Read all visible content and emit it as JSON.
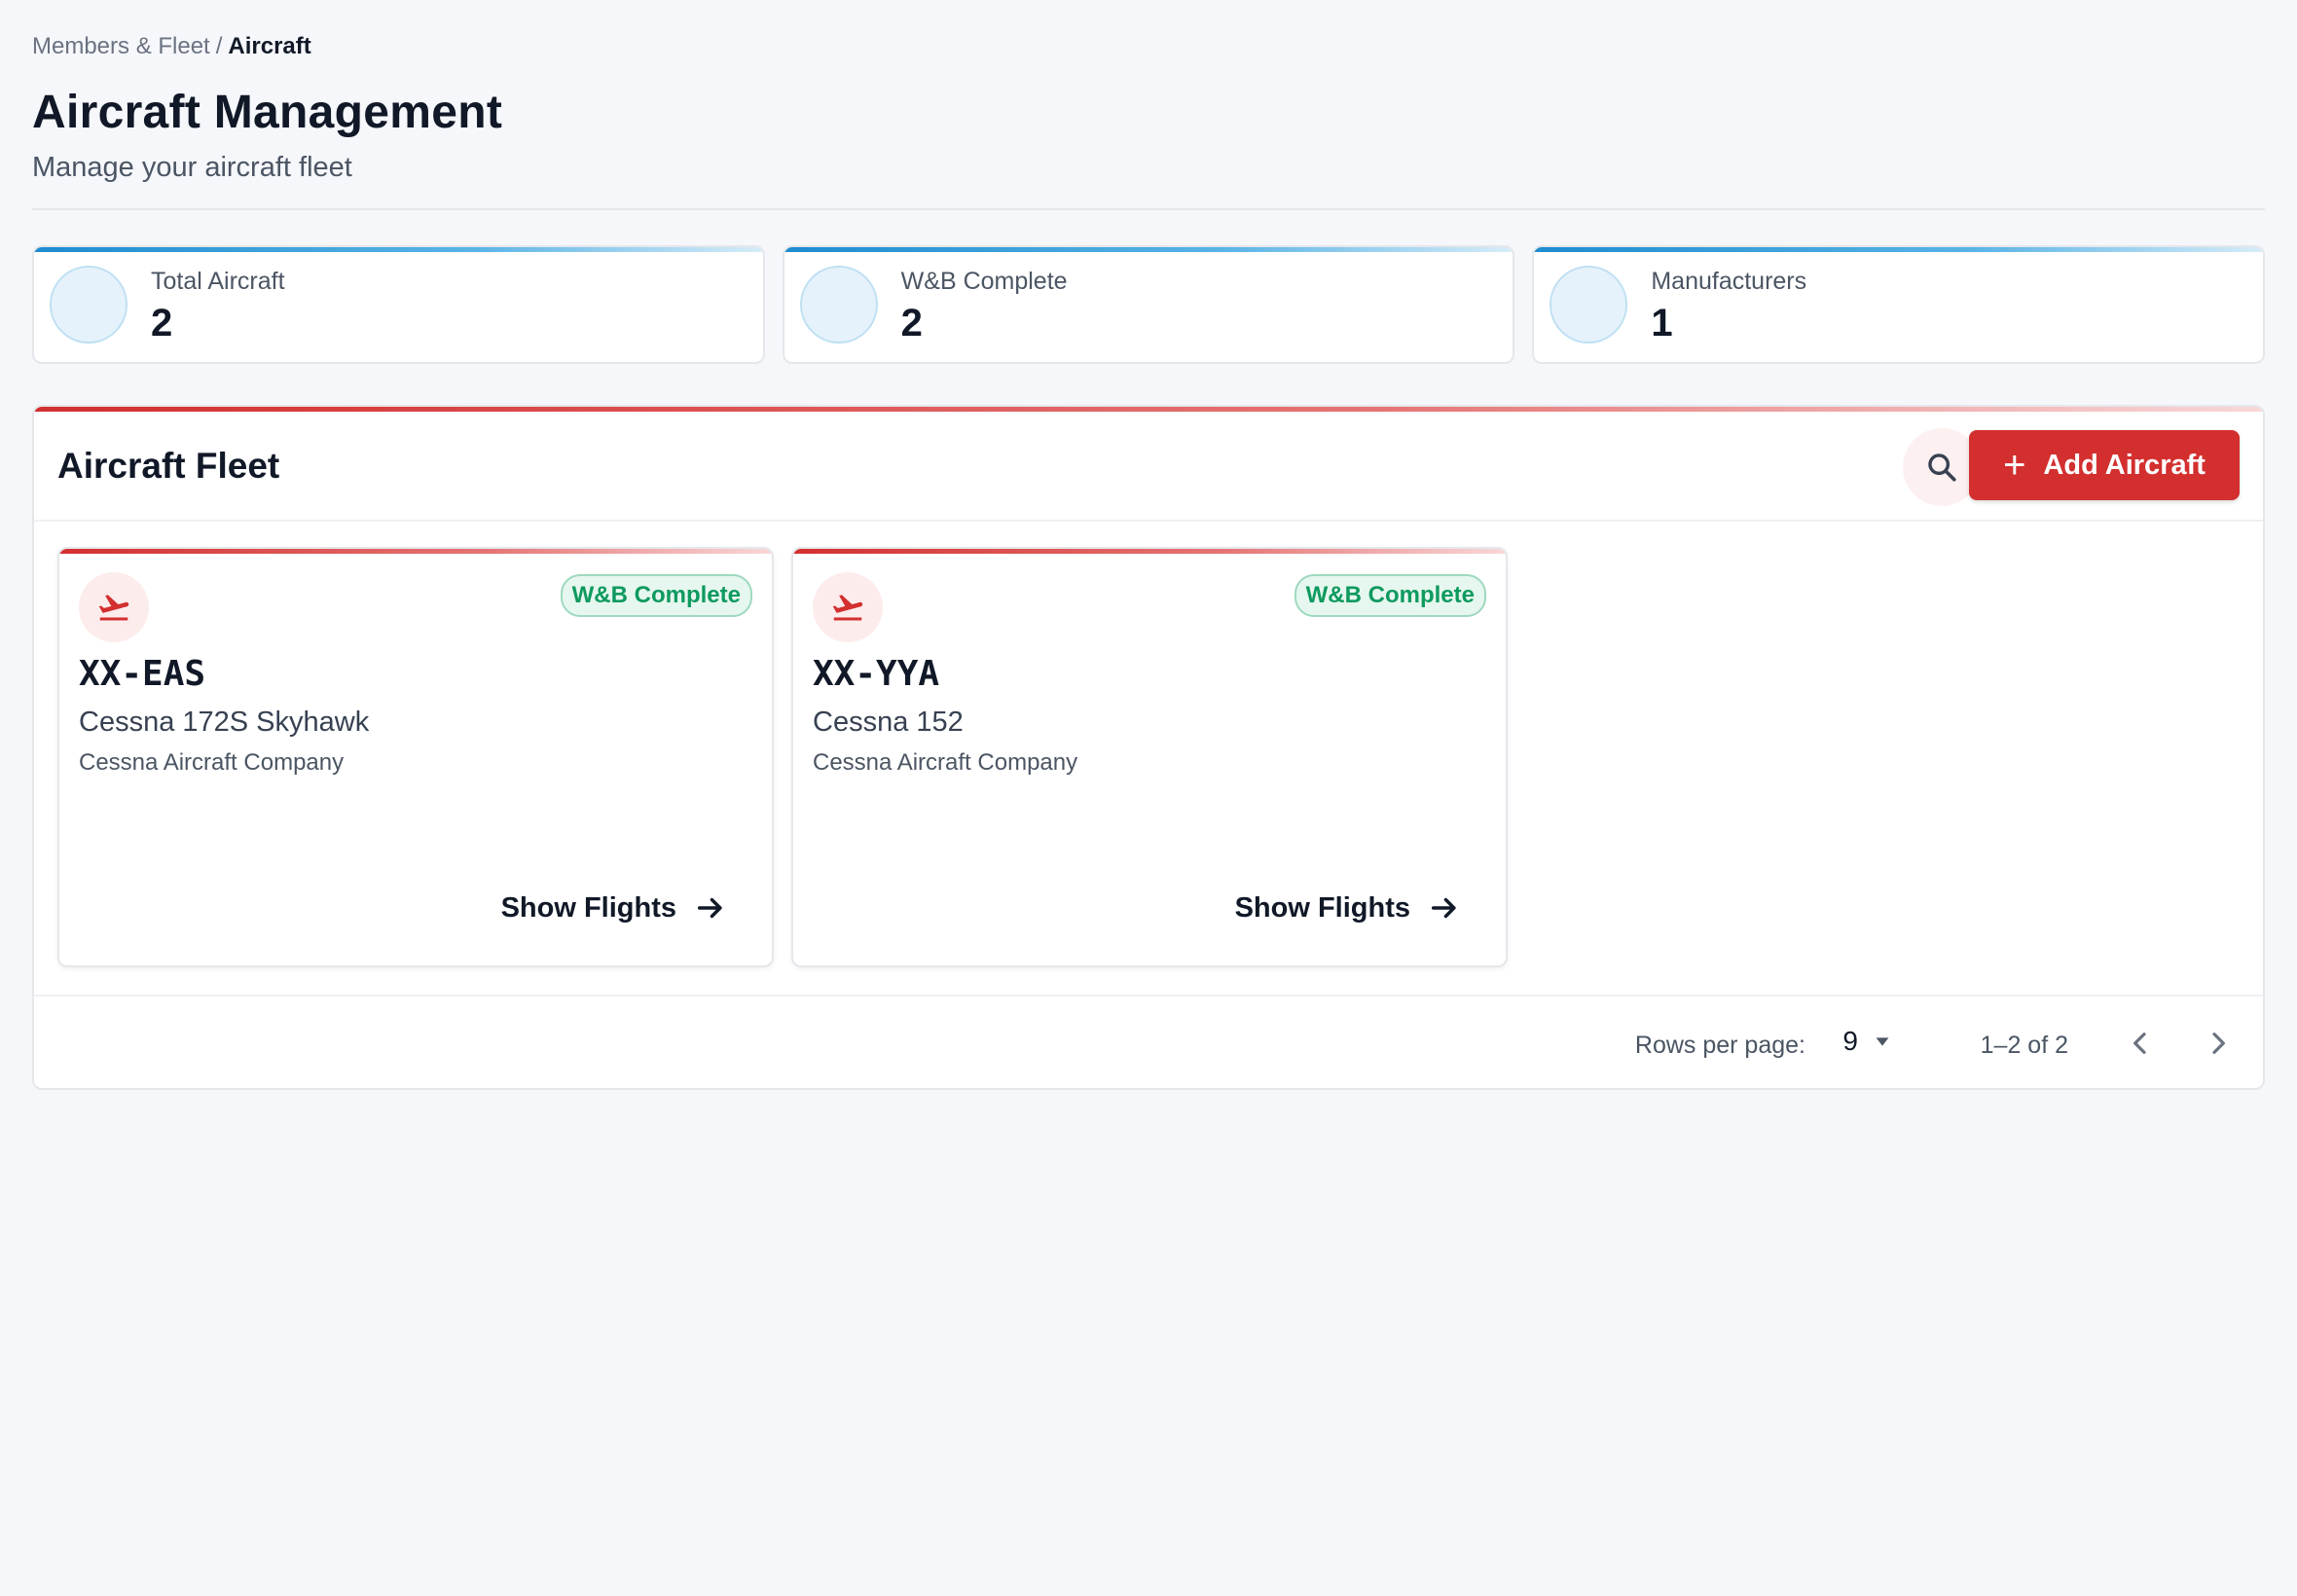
{
  "breadcrumb": {
    "parent": "Members & Fleet",
    "separator": "/",
    "current": "Aircraft"
  },
  "header": {
    "title": "Aircraft Management",
    "subtitle": "Manage your aircraft fleet"
  },
  "stats": [
    {
      "label": "Total Aircraft",
      "value": "2"
    },
    {
      "label": "W&B Complete",
      "value": "2"
    },
    {
      "label": "Manufacturers",
      "value": "1"
    }
  ],
  "fleet": {
    "title": "Aircraft Fleet",
    "add_label": "Add Aircraft",
    "search_icon": "search-icon",
    "aircraft": [
      {
        "registration": "XX-EAS",
        "model": "Cessna 172S Skyhawk",
        "manufacturer": "Cessna Aircraft Company",
        "badge": "W&B Complete",
        "action": "Show Flights",
        "icon": "flight-takeoff-icon"
      },
      {
        "registration": "XX-YYA",
        "model": "Cessna 152",
        "manufacturer": "Cessna Aircraft Company",
        "badge": "W&B Complete",
        "action": "Show Flights",
        "icon": "flight-takeoff-icon"
      }
    ]
  },
  "pagination": {
    "rows_label": "Rows per page:",
    "rows_value": "9",
    "range": "1–2 of 2"
  },
  "colors": {
    "accent": "#d32f2f",
    "stat_accent": "#1d8ccf",
    "badge_green": "#0e9a5f",
    "background": "#f5f7fb"
  }
}
